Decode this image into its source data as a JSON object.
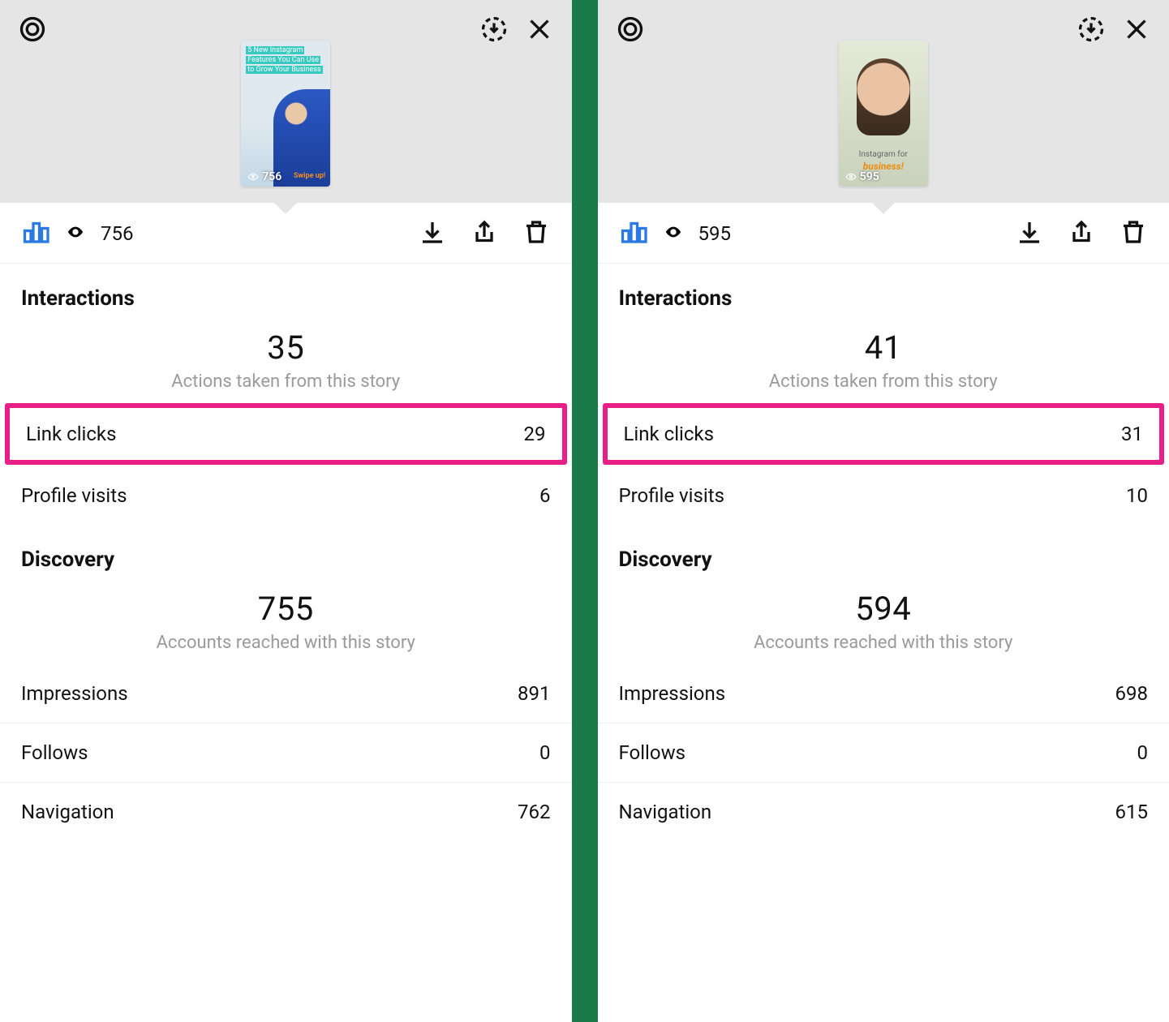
{
  "panels": [
    {
      "thumb_views": "756",
      "thumb_overlay_lines": [
        "5 New Instagram",
        "Features You Can Use",
        "to Grow Your Business"
      ],
      "thumb_swipe_text": "Swipe up!",
      "toolbar_views": "756",
      "interactions": {
        "title": "Interactions",
        "total": "35",
        "subtext": "Actions taken from this story",
        "link_clicks_label": "Link clicks",
        "link_clicks_value": "29",
        "profile_visits_label": "Profile visits",
        "profile_visits_value": "6"
      },
      "discovery": {
        "title": "Discovery",
        "total": "755",
        "subtext": "Accounts reached with this story",
        "rows": [
          {
            "label": "Impressions",
            "value": "891"
          },
          {
            "label": "Follows",
            "value": "0"
          },
          {
            "label": "Navigation",
            "value": "762"
          }
        ]
      }
    },
    {
      "thumb_views": "595",
      "thumb_caption_top": "Instagram for",
      "thumb_caption_bottom": "business!",
      "toolbar_views": "595",
      "interactions": {
        "title": "Interactions",
        "total": "41",
        "subtext": "Actions taken from this story",
        "link_clicks_label": "Link clicks",
        "link_clicks_value": "31",
        "profile_visits_label": "Profile visits",
        "profile_visits_value": "10"
      },
      "discovery": {
        "title": "Discovery",
        "total": "594",
        "subtext": "Accounts reached with this story",
        "rows": [
          {
            "label": "Impressions",
            "value": "698"
          },
          {
            "label": "Follows",
            "value": "0"
          },
          {
            "label": "Navigation",
            "value": "615"
          }
        ]
      }
    }
  ]
}
